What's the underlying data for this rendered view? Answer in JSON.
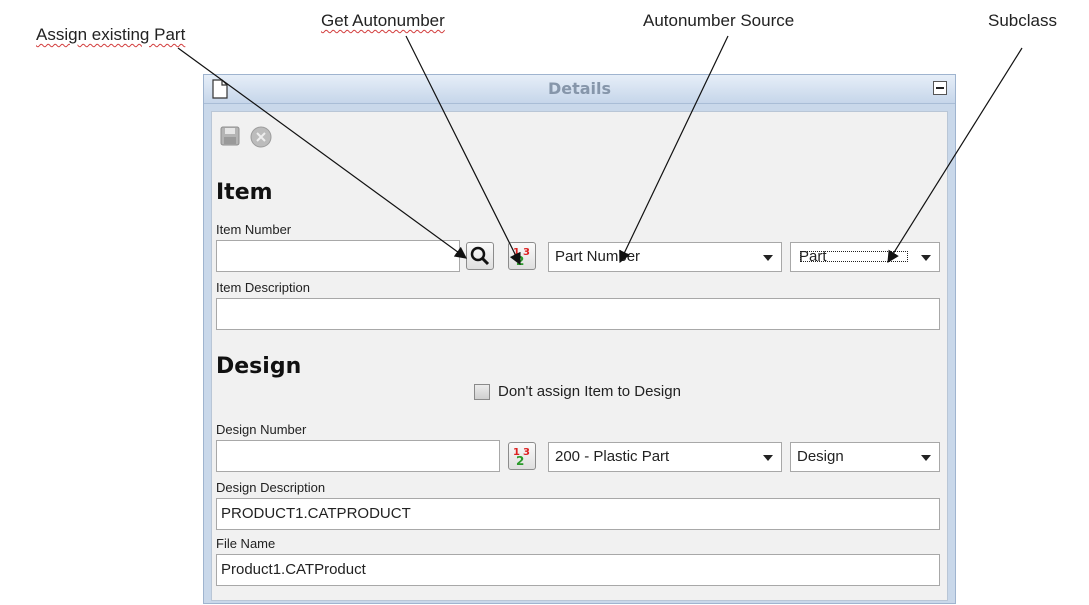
{
  "annotations": {
    "assign_existing": "Assign existing Part",
    "get_autonumber": "Get Autonumber",
    "autonumber_source": "Autonumber  Source",
    "subclass": "Subclass"
  },
  "panel": {
    "title": "Details",
    "icons": {
      "doc": "document-icon",
      "save": "save-icon",
      "cancel": "cancel-icon",
      "minimize": "minimize-icon",
      "search": "search-icon",
      "autonumber": "autonumber-icon"
    },
    "item": {
      "heading": "Item",
      "number_label": "Item Number",
      "number_value": "",
      "autonumber_source": "Part Number",
      "subclass": "Part",
      "description_label": "Item Description",
      "description_value": ""
    },
    "design": {
      "heading": "Design",
      "dont_assign_label": "Don't assign Item to Design",
      "dont_assign_checked": false,
      "number_label": "Design Number",
      "number_value": "",
      "autonumber_source": "200 - Plastic Part",
      "subclass": "Design",
      "description_label": "Design Description",
      "description_value": "PRODUCT1.CATPRODUCT",
      "filename_label": "File Name",
      "filename_value": "Product1.CATProduct"
    }
  },
  "colors": {
    "titlebar": "#c6d6ea",
    "body_bg": "#f1f1f1",
    "title_text": "#8696aa"
  }
}
